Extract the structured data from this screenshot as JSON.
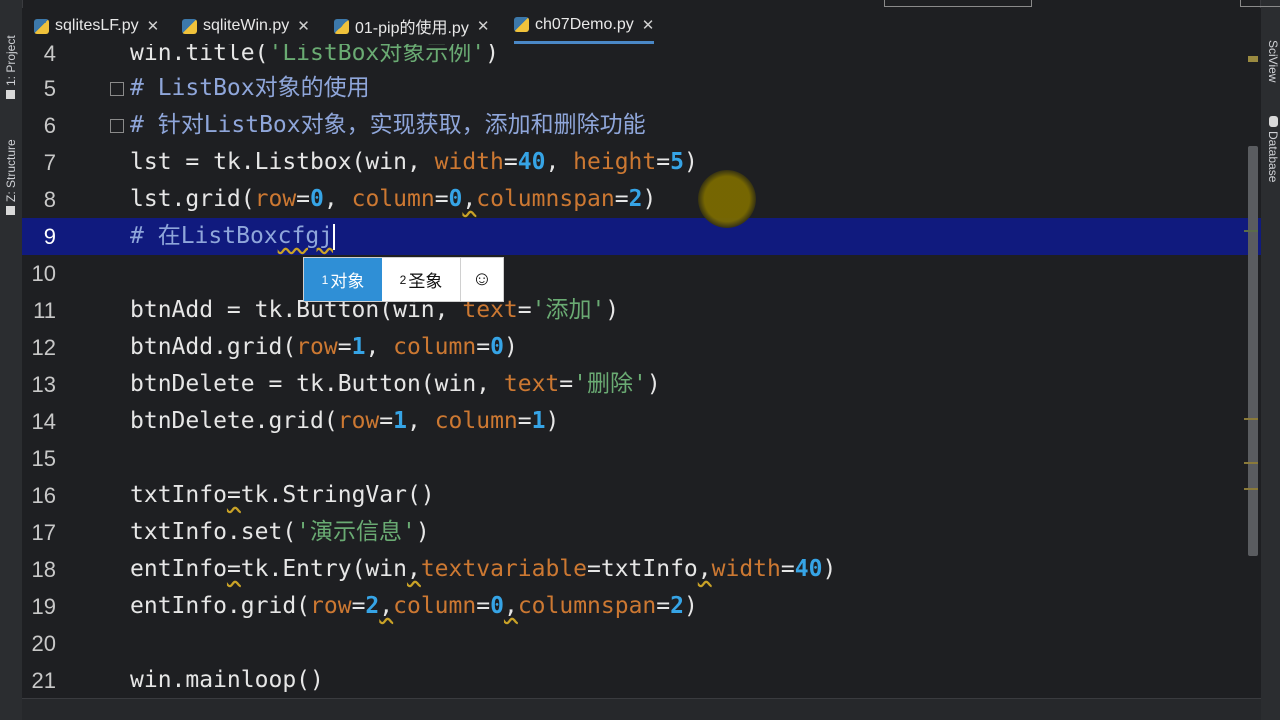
{
  "left_panel": {
    "project_label": "1: Project",
    "structure_label": "Z: Structure"
  },
  "right_panel": {
    "sciview_label": "SciView",
    "database_label": "Database"
  },
  "tabs": [
    {
      "label": "sqlitesLF.py",
      "active": false
    },
    {
      "label": "sqliteWin.py",
      "active": false
    },
    {
      "label": "01-pip的使用.py",
      "active": false
    },
    {
      "label": "ch07Demo.py",
      "active": true
    }
  ],
  "editor": {
    "line_numbers": [
      "4",
      "5",
      "6",
      "7",
      "8",
      "9",
      "10",
      "11",
      "12",
      "13",
      "14",
      "15",
      "16",
      "17",
      "18",
      "19",
      "20",
      "21"
    ],
    "current_line": "9",
    "lines": {
      "l4": "win.title('ListBox对象示例')",
      "l5": "# ListBox对象的使用",
      "l6": "# 针对ListBox对象，实现获取，添加和删除功能",
      "l9a": "# 在",
      "l9b": "ListBox",
      "l9c": "cfgj"
    }
  },
  "ime": {
    "candidates": [
      {
        "index": "1",
        "text": "对象"
      },
      {
        "index": "2",
        "text": "圣象"
      }
    ],
    "emoji": "☺"
  }
}
